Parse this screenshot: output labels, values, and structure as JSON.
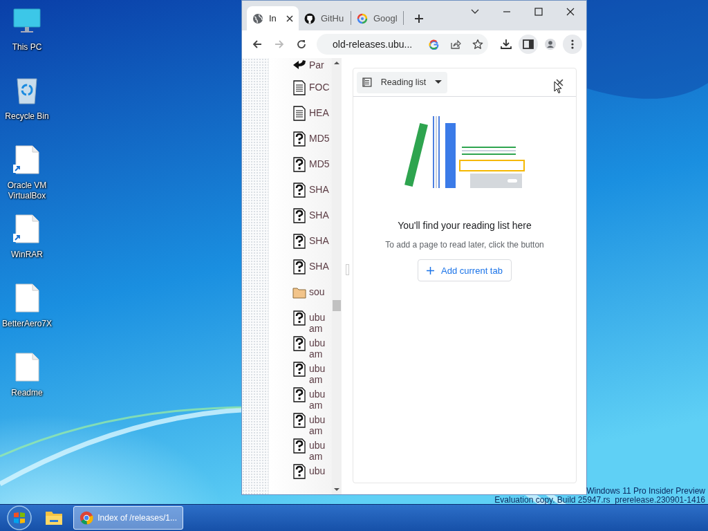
{
  "desktop_icons": [
    {
      "label": "This PC",
      "kind": "monitor",
      "shortcut": false
    },
    {
      "label": "Recycle Bin",
      "kind": "bin",
      "shortcut": false
    },
    {
      "label": "Oracle VM VirtualBox",
      "kind": "file",
      "shortcut": true
    },
    {
      "label": "WinRAR",
      "kind": "file",
      "shortcut": true
    },
    {
      "label": "BetterAero7X",
      "kind": "file",
      "shortcut": false
    },
    {
      "label": "Readme",
      "kind": "file",
      "shortcut": false
    }
  ],
  "browser": {
    "tabs": [
      {
        "title": "In",
        "kind": "globe",
        "selected": true
      },
      {
        "title": "GitHu",
        "kind": "octo",
        "selected": false
      },
      {
        "title": "Googl",
        "kind": "lens",
        "selected": false
      }
    ],
    "nav": [
      {
        "kind": "back",
        "disabled": false
      },
      {
        "kind": "forward",
        "disabled": true
      },
      {
        "kind": "reload",
        "disabled": false
      }
    ],
    "address": "old-releases.ubu...",
    "actions": [
      {
        "kind": "download",
        "selected": false
      },
      {
        "kind": "side-panel",
        "selected": true
      },
      {
        "kind": "profile",
        "selected": false
      },
      {
        "kind": "menu",
        "selected": true
      }
    ],
    "listing": [
      {
        "kind": "parent",
        "lines": [
          "Par"
        ]
      },
      {
        "kind": "text",
        "lines": [
          "FOC"
        ]
      },
      {
        "kind": "text",
        "lines": [
          "HEA"
        ]
      },
      {
        "kind": "unknown",
        "lines": [
          "MD5"
        ]
      },
      {
        "kind": "unknown",
        "lines": [
          "MD5"
        ]
      },
      {
        "kind": "unknown",
        "lines": [
          "SHA"
        ]
      },
      {
        "kind": "unknown",
        "lines": [
          "SHA"
        ]
      },
      {
        "kind": "unknown",
        "lines": [
          "SHA"
        ]
      },
      {
        "kind": "unknown",
        "lines": [
          "SHA"
        ]
      },
      {
        "kind": "folder",
        "lines": [
          "sou"
        ]
      },
      {
        "kind": "unknown",
        "lines": [
          "ubu",
          "am"
        ]
      },
      {
        "kind": "unknown",
        "lines": [
          "ubu",
          "am"
        ]
      },
      {
        "kind": "unknown",
        "lines": [
          "ubu",
          "am"
        ]
      },
      {
        "kind": "unknown",
        "lines": [
          "ubu",
          "am"
        ]
      },
      {
        "kind": "unknown",
        "lines": [
          "ubu",
          "am"
        ]
      },
      {
        "kind": "unknown",
        "lines": [
          "ubu",
          "am"
        ]
      },
      {
        "kind": "unknown",
        "lines": [
          "ubu"
        ]
      }
    ],
    "side_panel": {
      "selector": "Reading list",
      "title": "You'll find your reading list here",
      "hint": "To add a page to read later, click the button",
      "button": "Add current tab"
    }
  },
  "watermark": [
    "Windows 11 Pro Insider Preview",
    "Evaluation copy. Build 25947.rs_prerelease.230901-1416"
  ],
  "taskbar": {
    "items": [
      {
        "kind": "start"
      },
      {
        "kind": "explorer"
      },
      {
        "kind": "chrome",
        "title": "Index of /releases/1..."
      }
    ]
  }
}
